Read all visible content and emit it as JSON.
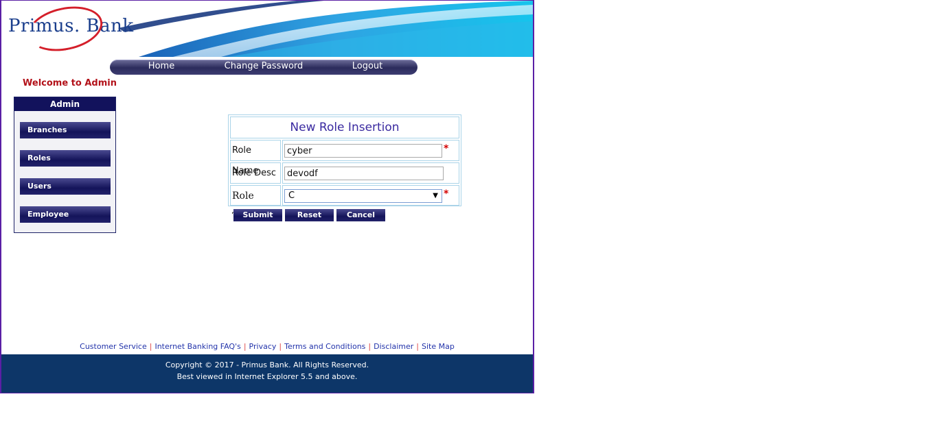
{
  "brand": {
    "logo_text": "Primus. Bank"
  },
  "nav": {
    "items": [
      "Home",
      "Change Password",
      "Logout"
    ]
  },
  "welcome": "Welcome to Admin",
  "sidebar": {
    "header": "Admin",
    "items": [
      "Branches",
      "Roles",
      "Users",
      "Employee"
    ]
  },
  "form": {
    "title": "New Role Insertion",
    "role_name_label": "Role Name",
    "role_name_value": "cyber",
    "role_desc_label": "Role Desc",
    "role_desc_value": "devodf",
    "role_type_label": "Role Type",
    "role_type_value": "C",
    "required_mark": "*",
    "buttons": {
      "submit": "Submit",
      "reset": "Reset",
      "cancel": "Cancel"
    }
  },
  "footer_links": [
    "Customer Service",
    "Internet Banking FAQ's",
    "Privacy",
    "Terms and Conditions",
    "Disclaimer",
    "Site Map"
  ],
  "footer_separator": "|",
  "footer": {
    "copyright": "Copyright © 2017 - Primus Bank. All Rights Reserved.",
    "browser_note": "Best viewed in Internet Explorer 5.5 and above."
  },
  "colors": {
    "accent": "#12125c",
    "footer_bg": "#0d3668",
    "welcome": "#b3121a",
    "required": "#d40000"
  }
}
